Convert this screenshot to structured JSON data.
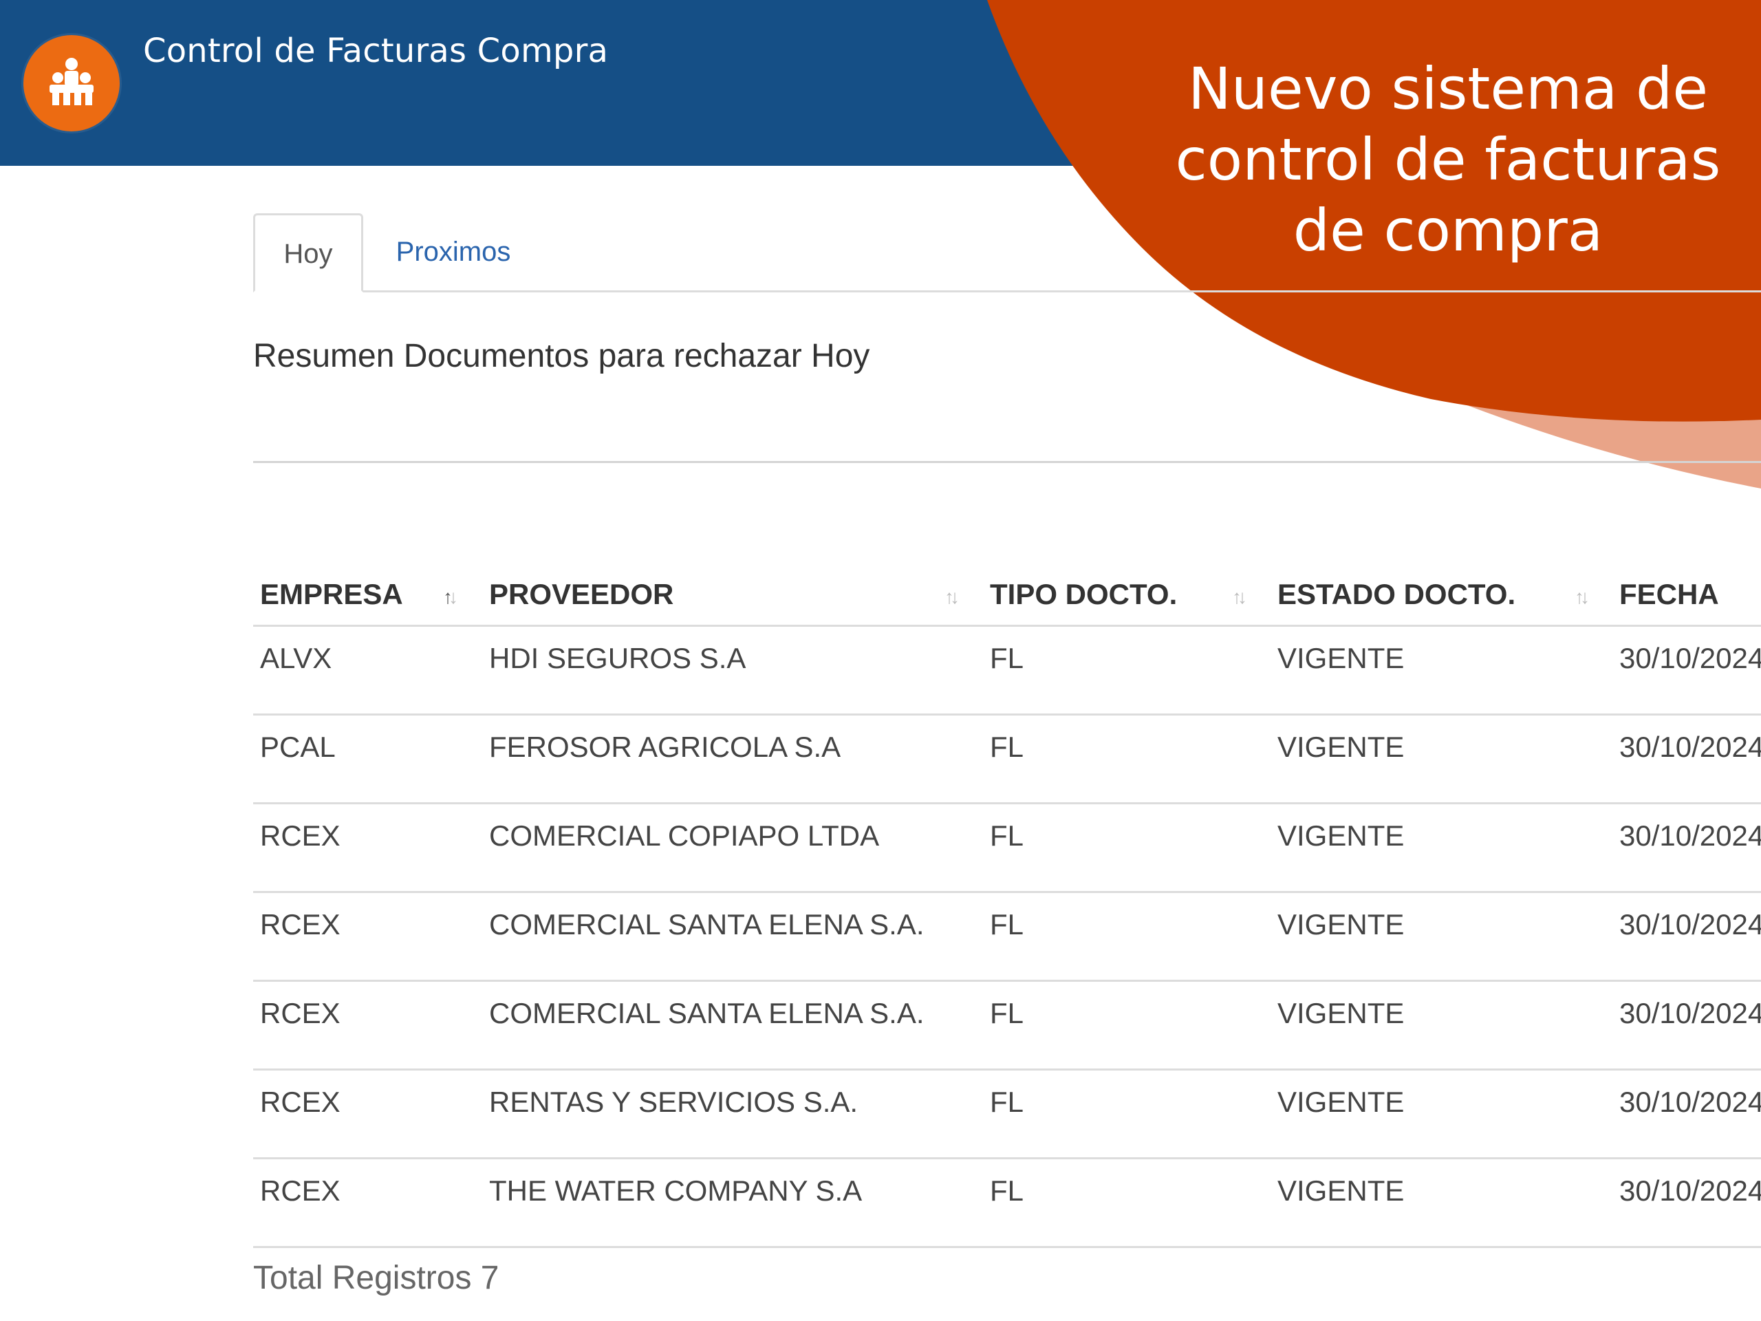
{
  "header": {
    "app_title": "Control de Facturas Compra",
    "logo_icon": "people-group-icon",
    "background_color": "#154f86",
    "logo_color": "#ec6b12"
  },
  "banner": {
    "lines": [
      "Nuevo sistema de",
      "control de facturas",
      "de compra"
    ],
    "color": "#c94000",
    "shadow_color": "#e9a488"
  },
  "tabs": [
    {
      "label": "Hoy",
      "active": true
    },
    {
      "label": "Proximos",
      "active": false
    }
  ],
  "section_title": "Resumen Documentos para rechazar Hoy",
  "table": {
    "columns": [
      {
        "label": "EMPRESA",
        "sort_icon": "sort-icon"
      },
      {
        "label": "PROVEEDOR",
        "sort_icon": "sort-icon"
      },
      {
        "label": "TIPO DOCTO.",
        "sort_icon": "sort-icon"
      },
      {
        "label": "ESTADO DOCTO.",
        "sort_icon": "sort-icon"
      },
      {
        "label": "FECHA"
      }
    ],
    "rows": [
      {
        "empresa": "ALVX",
        "proveedor": "HDI SEGUROS S.A",
        "tipo": "FL",
        "estado": "VIGENTE",
        "fecha": "30/10/2024"
      },
      {
        "empresa": "PCAL",
        "proveedor": "FEROSOR AGRICOLA S.A",
        "tipo": "FL",
        "estado": "VIGENTE",
        "fecha": "30/10/2024"
      },
      {
        "empresa": "RCEX",
        "proveedor": "COMERCIAL COPIAPO LTDA",
        "tipo": "FL",
        "estado": "VIGENTE",
        "fecha": "30/10/2024"
      },
      {
        "empresa": "RCEX",
        "proveedor": "COMERCIAL SANTA ELENA S.A.",
        "tipo": "FL",
        "estado": "VIGENTE",
        "fecha": "30/10/2024"
      },
      {
        "empresa": "RCEX",
        "proveedor": "COMERCIAL SANTA ELENA S.A.",
        "tipo": "FL",
        "estado": "VIGENTE",
        "fecha": "30/10/2024"
      },
      {
        "empresa": "RCEX",
        "proveedor": "RENTAS Y SERVICIOS S.A.",
        "tipo": "FL",
        "estado": "VIGENTE",
        "fecha": "30/10/2024"
      },
      {
        "empresa": "RCEX",
        "proveedor": "THE WATER COMPANY S.A",
        "tipo": "FL",
        "estado": "VIGENTE",
        "fecha": "30/10/2024"
      }
    ]
  },
  "total_label": "Total Registros 7"
}
